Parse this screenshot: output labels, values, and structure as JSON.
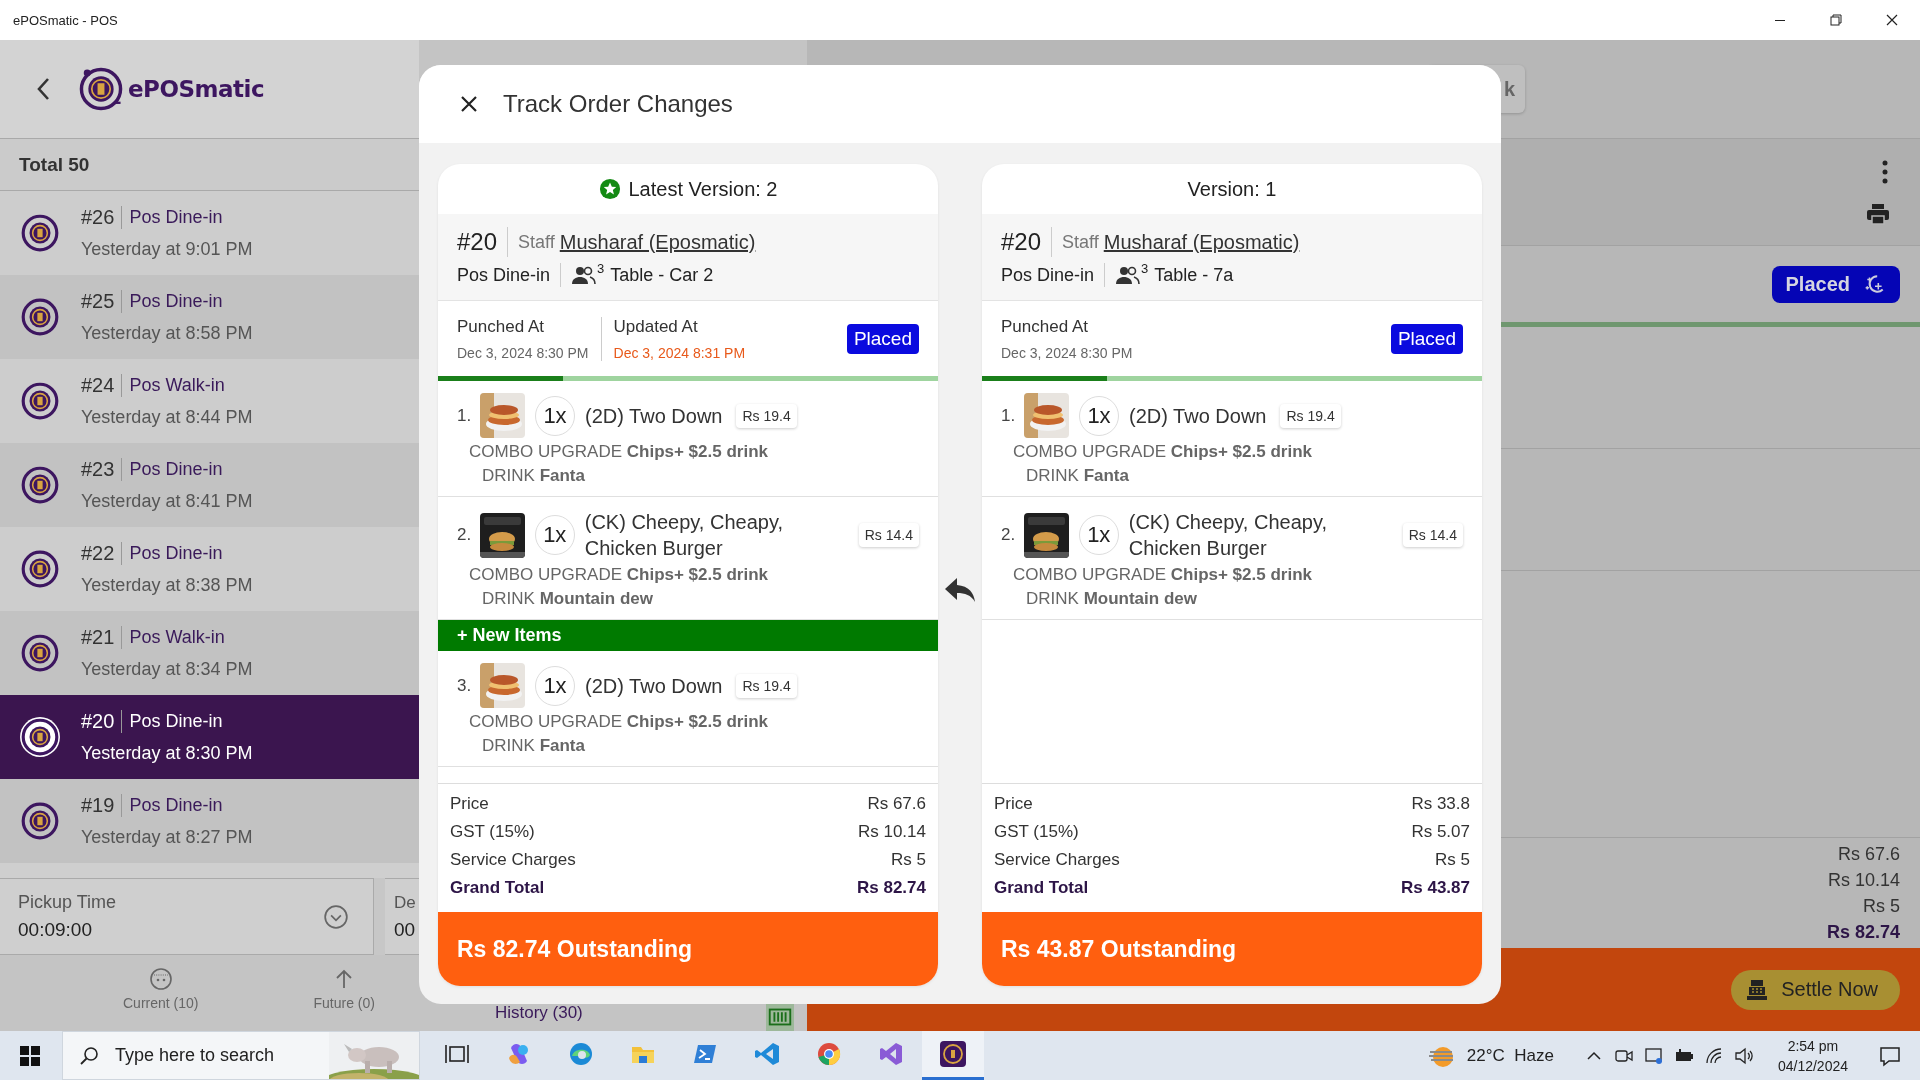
{
  "window": {
    "title": "ePOSmatic - POS"
  },
  "sidebar": {
    "brand": "ePOSmatic",
    "total": "Total 50",
    "orders": [
      {
        "number": "#26",
        "type": "Pos Dine-in",
        "time": "Yesterday at 9:01 PM",
        "selected": false
      },
      {
        "number": "#25",
        "type": "Pos Dine-in",
        "time": "Yesterday at 8:58 PM",
        "selected": false
      },
      {
        "number": "#24",
        "type": "Pos Walk-in",
        "time": "Yesterday at 8:44 PM",
        "selected": false
      },
      {
        "number": "#23",
        "type": "Pos Dine-in",
        "time": "Yesterday at 8:41 PM",
        "selected": false
      },
      {
        "number": "#22",
        "type": "Pos Dine-in",
        "time": "Yesterday at 8:38 PM",
        "selected": false
      },
      {
        "number": "#21",
        "type": "Pos Walk-in",
        "time": "Yesterday at 8:34 PM",
        "selected": false
      },
      {
        "number": "#20",
        "type": "Pos Dine-in",
        "time": "Yesterday at 8:30 PM",
        "selected": true
      },
      {
        "number": "#19",
        "type": "Pos Dine-in",
        "time": "Yesterday at 8:27 PM",
        "selected": false
      }
    ],
    "fields": [
      {
        "label": "Pickup Time",
        "value": "00:09:00"
      },
      {
        "label": "De",
        "value": "00"
      }
    ],
    "nav": [
      {
        "kind": "current",
        "label": "Current (10)"
      },
      {
        "kind": "future",
        "label": "Future (0)"
      },
      {
        "kind": "history",
        "label": "History (30)"
      }
    ]
  },
  "background": {
    "button_text": "k",
    "status": "Placed",
    "totals": [
      "Rs 67.6",
      "Rs 10.14",
      "Rs 5",
      "Rs 82.74"
    ],
    "settle_button": "Settle Now"
  },
  "modal": {
    "title": "Track Order Changes",
    "versions": [
      {
        "title": "Latest Version: 2",
        "latest": true,
        "order_number": "#20",
        "staff_label": "Staff",
        "staff_name": "Musharaf (Eposmatic)",
        "order_type": "Pos Dine-in",
        "guests": "3",
        "table": "Table - Car 2",
        "punched_label": "Punched At",
        "punched_at": "Dec 3, 2024 8:30 PM",
        "updated_label": "Updated At",
        "updated_at": "Dec 3, 2024 8:31 PM",
        "status": "Placed",
        "progress": {
          "level": 0.25
        },
        "items": [
          {
            "index": "1.",
            "qty": "1x",
            "name": "(2D) Two Down",
            "price": "Rs 19.4",
            "modifiers": [
              {
                "group": "COMBO UPGRADE",
                "choice": "Chips+ $2.5 drink"
              },
              {
                "group": "DRINK",
                "choice": "Fanta"
              }
            ]
          },
          {
            "index": "2.",
            "qty": "1x",
            "name": "(CK) Cheepy, Cheapy, Chicken Burger",
            "price": "Rs 14.4",
            "modifiers": [
              {
                "group": "COMBO UPGRADE",
                "choice": "Chips+ $2.5 drink"
              },
              {
                "group": "DRINK",
                "choice": "Mountain dew"
              }
            ]
          }
        ],
        "new_items": {
          "label": "+ New Items",
          "items": [
            {
              "index": "3.",
              "qty": "1x",
              "name": "(2D) Two Down",
              "price": "Rs 19.4",
              "modifiers": [
                {
                  "group": "COMBO UPGRADE",
                  "choice": "Chips+ $2.5 drink"
                },
                {
                  "group": "DRINK",
                  "choice": "Fanta"
                }
              ]
            }
          ]
        },
        "totals": [
          {
            "kind": "normal",
            "label": "Price",
            "value": "Rs 67.6"
          },
          {
            "kind": "normal",
            "label": "GST (15%)",
            "value": "Rs 10.14"
          },
          {
            "kind": "normal",
            "label": "Service Charges",
            "value": "Rs 5"
          },
          {
            "kind": "grand",
            "label": "Grand Total",
            "value": "Rs 82.74"
          }
        ],
        "outstanding": "Rs 82.74 Outstanding"
      },
      {
        "title": "Version: 1",
        "latest": false,
        "order_number": "#20",
        "staff_label": "Staff",
        "staff_name": "Musharaf (Eposmatic)",
        "order_type": "Pos Dine-in",
        "guests": "3",
        "table": "Table - 7a",
        "punched_label": "Punched At",
        "punched_at": "Dec 3, 2024 8:30 PM",
        "status": "Placed",
        "progress": {
          "level": 0.25
        },
        "items": [
          {
            "index": "1.",
            "qty": "1x",
            "name": "(2D) Two Down",
            "price": "Rs 19.4",
            "modifiers": [
              {
                "group": "COMBO UPGRADE",
                "choice": "Chips+ $2.5 drink"
              },
              {
                "group": "DRINK",
                "choice": "Fanta"
              }
            ]
          },
          {
            "index": "2.",
            "qty": "1x",
            "name": "(CK) Cheepy, Cheapy, Chicken Burger",
            "price": "Rs 14.4",
            "modifiers": [
              {
                "group": "COMBO UPGRADE",
                "choice": "Chips+ $2.5 drink"
              },
              {
                "group": "DRINK",
                "choice": "Mountain dew"
              }
            ]
          }
        ],
        "totals": [
          {
            "kind": "normal",
            "label": "Price",
            "value": "Rs 33.8"
          },
          {
            "kind": "normal",
            "label": "GST (15%)",
            "value": "Rs 5.07"
          },
          {
            "kind": "normal",
            "label": "Service Charges",
            "value": "Rs 5"
          },
          {
            "kind": "grand",
            "label": "Grand Total",
            "value": "Rs 43.87"
          }
        ],
        "outstanding": "Rs 43.87 Outstanding"
      }
    ]
  },
  "taskbar": {
    "search_placeholder": "Type here to search",
    "apps": [
      {
        "kind": "taskview",
        "active": false
      },
      {
        "kind": "copilot",
        "active": false
      },
      {
        "kind": "edge",
        "active": false
      },
      {
        "kind": "explorer",
        "active": false
      },
      {
        "kind": "terminal",
        "active": false
      },
      {
        "kind": "vscode",
        "active": false
      },
      {
        "kind": "chrome",
        "active": false
      },
      {
        "kind": "vstudio",
        "active": false
      },
      {
        "kind": "epos",
        "active": true
      }
    ],
    "weather": "22°C  Haze",
    "time": "2:54 pm",
    "date": "04/12/2024"
  }
}
